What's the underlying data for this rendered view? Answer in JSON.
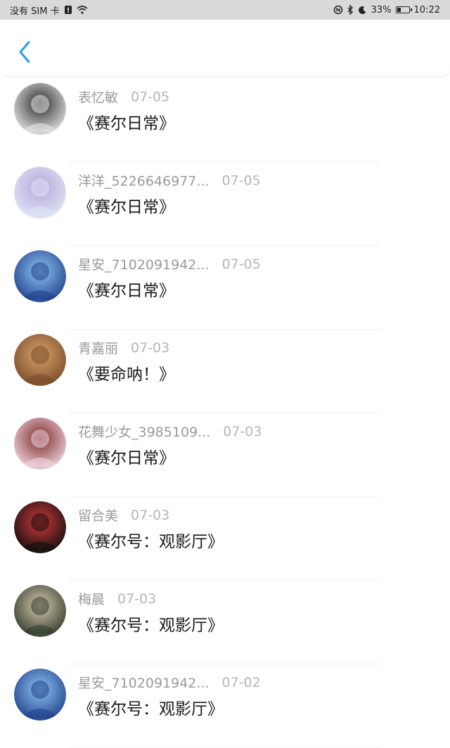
{
  "status_bar": {
    "carrier": "没有 SIM 卡",
    "battery": "33%",
    "time": "10:22",
    "battery_level": 0.33
  },
  "header": {
    "back_icon": "chevron-left-icon",
    "accent": "#2d9cf0"
  },
  "comments": [
    {
      "name": "表忆敏",
      "date": "07-05",
      "work": "《赛尔日常》",
      "avatar_colors": [
        "#e9e9e9",
        "#2b2b2b"
      ]
    },
    {
      "name": "洋洋_5226646977...",
      "date": "07-05",
      "work": "《赛尔日常》",
      "avatar_colors": [
        "#dfe6f7",
        "#b9a6d9"
      ]
    },
    {
      "name": "星安_7102091942...",
      "date": "07-05",
      "work": "《赛尔日常》",
      "avatar_colors": [
        "#1f3f8a",
        "#8fc4f2"
      ]
    },
    {
      "name": "青嘉丽",
      "date": "07-03",
      "work": "《要命呐！》",
      "avatar_colors": [
        "#7a4a2a",
        "#d8a36a"
      ]
    },
    {
      "name": "花舞少女_3985109...",
      "date": "07-03",
      "work": "《赛尔日常》",
      "avatar_colors": [
        "#f3d9e3",
        "#7a2a2a"
      ]
    },
    {
      "name": "留合美",
      "date": "07-03",
      "work": "《赛尔号：观影厅》",
      "avatar_colors": [
        "#0d0d0d",
        "#d23a3a"
      ]
    },
    {
      "name": "梅晨",
      "date": "07-03",
      "work": "《赛尔号：观影厅》",
      "avatar_colors": [
        "#2e3a2a",
        "#d9c8b0"
      ]
    },
    {
      "name": "星安_7102091942...",
      "date": "07-02",
      "work": "《赛尔号：观影厅》",
      "avatar_colors": [
        "#1f3f8a",
        "#8fc4f2"
      ]
    }
  ]
}
